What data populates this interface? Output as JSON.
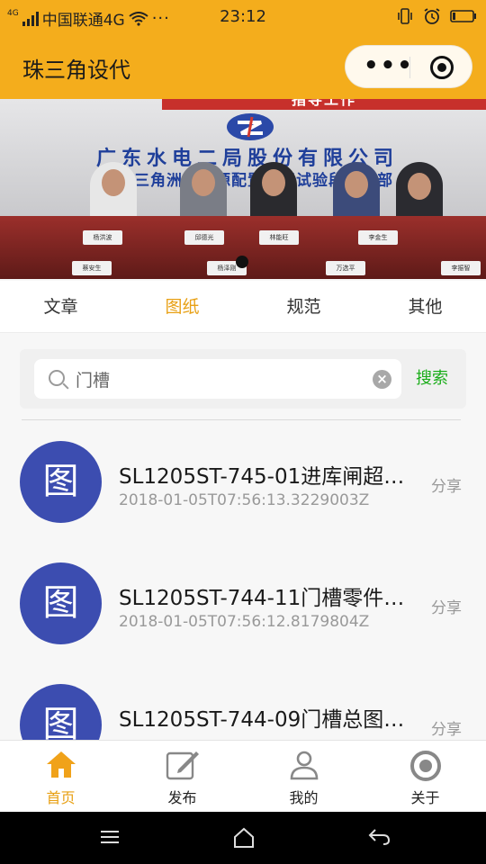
{
  "status_bar": {
    "network": "4G",
    "carrier": "中国联通4G",
    "more": "···",
    "time": "23:12"
  },
  "header": {
    "title": "珠三角设代",
    "more_icon": "more-dots-icon",
    "close_icon": "target-icon"
  },
  "banner": {
    "headline": "广东水电二局股份有限公司",
    "subline": "珠江三角洲水资源配置工程试验段项目部",
    "top_text": "指导工作",
    "name_plates": [
      "杨洪波",
      "邱德光",
      "林能旺",
      "李金生",
      "蔡安生",
      "杨泽刚",
      "万选平",
      "李振智"
    ]
  },
  "tabs": [
    "文章",
    "图纸",
    "规范",
    "其他"
  ],
  "active_tab": "图纸",
  "search": {
    "value": "门槽",
    "button": "搜索"
  },
  "list": [
    {
      "avatar": "图",
      "title": "SL1205ST-745-01进库闸超…",
      "time": "2018-01-05T07:56:13.3229003Z",
      "action": "分享"
    },
    {
      "avatar": "图",
      "title": "SL1205ST-744-11门槽零件…",
      "time": "2018-01-05T07:56:12.8179804Z",
      "action": "分享"
    },
    {
      "avatar": "图",
      "title": "SL1205ST-744-09门槽总图…",
      "time": "",
      "action": "分享"
    }
  ],
  "bottom_tabs": [
    {
      "label": "首页",
      "icon": "home-icon",
      "active": true
    },
    {
      "label": "发布",
      "icon": "edit-icon",
      "active": false
    },
    {
      "label": "我的",
      "icon": "user-icon",
      "active": false
    },
    {
      "label": "关于",
      "icon": "about-target-icon",
      "active": false
    }
  ],
  "colors": {
    "brand": "#f4ad1c",
    "active_tab": "#e8a014",
    "avatar": "#3c4db0",
    "search_button": "#1aad19"
  }
}
